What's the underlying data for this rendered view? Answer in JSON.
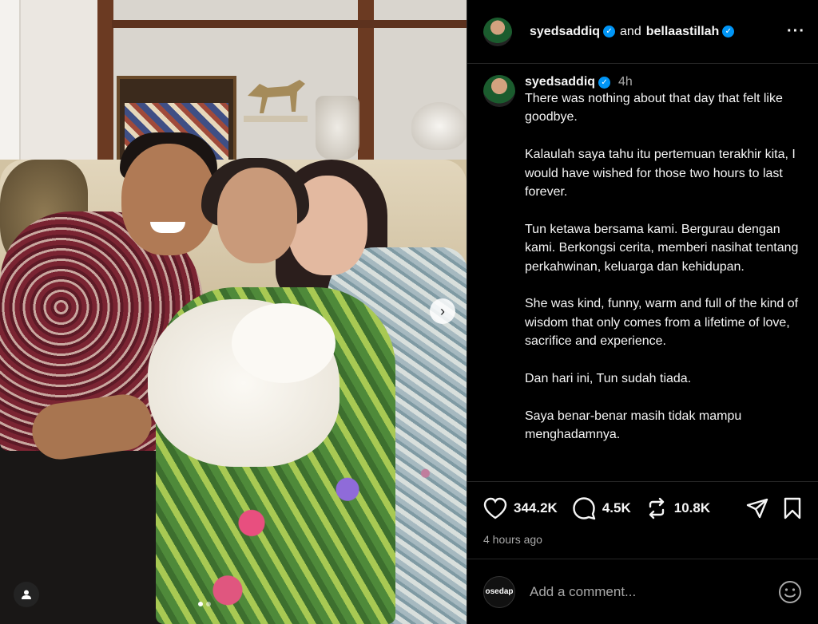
{
  "header": {
    "user1": "syedsaddiq",
    "and_text": "and",
    "user2": "bellaastillah",
    "more_icon": "more-horizontal-icon"
  },
  "caption": {
    "username": "syedsaddiq",
    "time": "4h",
    "paragraphs": [
      "There was nothing about that day that felt like goodbye.",
      "Kalaulah saya tahu itu pertemuan terakhir kita, I would have wished for those two hours to last forever.",
      "Tun ketawa bersama kami. Bergurau dengan kami. Berkongsi cerita, memberi nasihat tentang perkahwinan, keluarga dan kehidupan.",
      "She was kind, funny, warm and full of the kind of wisdom that only comes from a lifetime of love, sacrifice and experience.",
      "Dan hari ini, Tun sudah tiada.",
      "Saya benar-benar masih tidak mampu menghadamnya."
    ]
  },
  "actions": {
    "likes": "344.2K",
    "comments": "4.5K",
    "reposts": "10.8K",
    "posted": "4 hours ago"
  },
  "comment_box": {
    "avatar_text": "osedap",
    "placeholder": "Add a comment..."
  },
  "carousel": {
    "total_slides": 2,
    "active_slide": 1
  },
  "colors": {
    "verified": "#0095f6",
    "background": "#000000",
    "muted": "#a8a8a8"
  }
}
